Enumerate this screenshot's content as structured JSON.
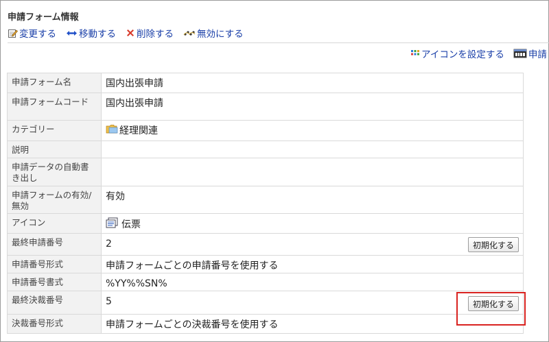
{
  "page": {
    "title": "申請フォーム情報"
  },
  "toolbar": {
    "edit_label": "変更する",
    "move_label": "移動する",
    "delete_label": "削除する",
    "disable_label": "無効にする"
  },
  "right_tools": {
    "set_icon_label": "アイコンを設定する",
    "cut_label": "申請"
  },
  "rows": [
    {
      "key": "申請フォーム名",
      "value": "国内出張申請"
    },
    {
      "key": "申請フォームコード",
      "value": "国内出張申請"
    },
    {
      "key": "カテゴリー",
      "value": "経理関連"
    },
    {
      "key": "説明",
      "value": ""
    },
    {
      "key": "申請データの自動書き出し",
      "value": ""
    },
    {
      "key": "申請フォームの有効/無効",
      "value": "有効"
    },
    {
      "key": "アイコン",
      "value": "伝票"
    },
    {
      "key": "最終申請番号",
      "value": "2",
      "button": "初期化する"
    },
    {
      "key": "申請番号形式",
      "value": "申請フォームごとの申請番号を使用する"
    },
    {
      "key": "申請番号書式",
      "value": "%YY%%SN%"
    },
    {
      "key": "最終決裁番号",
      "value": "5",
      "button": "初期化する"
    },
    {
      "key": "決裁番号形式",
      "value": "申請フォームごとの決裁番号を使用する"
    }
  ],
  "colors": {
    "link": "#1a3fa8",
    "status_active": "#1f8a1f",
    "highlight": "#d9221f"
  }
}
